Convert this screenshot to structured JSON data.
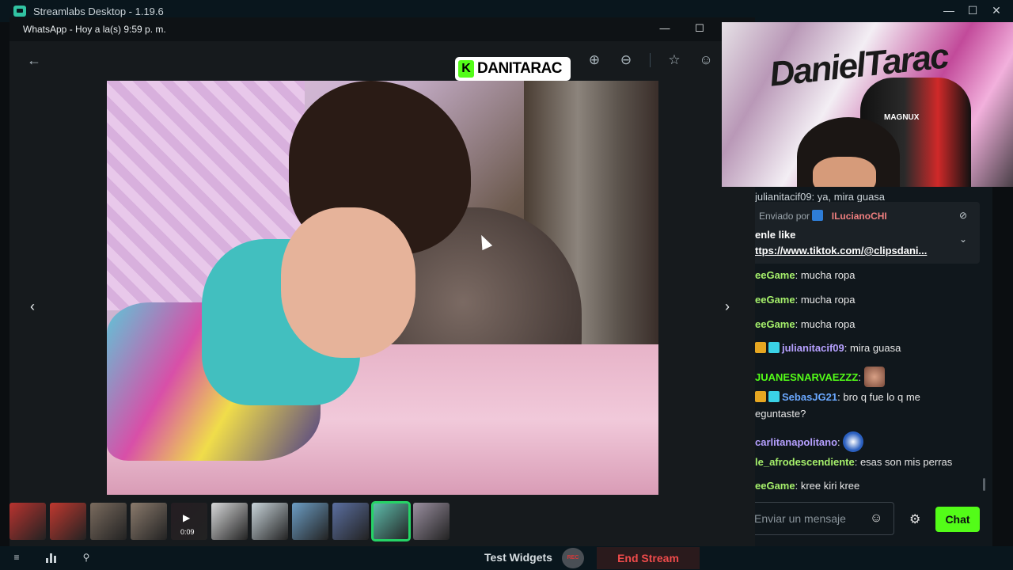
{
  "app": {
    "title": "Streamlabs Desktop - 1.19.6",
    "controls": {
      "minimize": "—",
      "maximize": "☐",
      "close": "✕"
    }
  },
  "whatsapp": {
    "title": "WhatsApp - Hoy a la(s) 9:59 p. m.",
    "controls": {
      "minimize": "—",
      "maximize": "☐"
    },
    "back_icon": "←",
    "prev_icon": "‹",
    "next_icon": "›",
    "toolbar": {
      "zoom_in": "⊕",
      "zoom_out": "⊖",
      "star": "☆",
      "emoji": "☺"
    },
    "thumbnails": [
      {
        "color": "#b9332f"
      },
      {
        "color": "#c0382f"
      },
      {
        "color": "#7a6b5e"
      },
      {
        "color": "#8a7a6c"
      },
      {
        "color": "#241d22",
        "duration": "0:09"
      },
      {
        "color": "#d7d8d9"
      },
      {
        "color": "#c8d4da"
      },
      {
        "color": "#6c9dc4"
      },
      {
        "color": "#5b6fa0"
      },
      {
        "color": "#5fbfae",
        "selected": true
      },
      {
        "color": "#9a8fa0"
      }
    ]
  },
  "overlay": {
    "kick_letter": "K",
    "kick_name": "DANITARAC"
  },
  "webcam": {
    "graffiti": "DanielTarac",
    "chair_label": "MAGNUX"
  },
  "chat": {
    "top_line": "julianitacif09: ya, mira guasa",
    "pinned": {
      "sent_by": "Enviado por",
      "sender": "ILucianoCHI",
      "line1": "enle like",
      "line2": "ttps://www.tiktok.com/@clipsdani..."
    },
    "messages": [
      {
        "user": "eeGame",
        "text": "mucha ropa",
        "color": "u-lime"
      },
      {
        "user": "eeGame",
        "text": "mucha ropa",
        "color": "u-lime"
      },
      {
        "user": "eeGame",
        "text": "mucha ropa",
        "color": "u-lime"
      },
      {
        "user": "julianitacif09",
        "text": "mira guasa",
        "color": "u-purple"
      },
      {
        "user": "JUANESNARVAEZZZ",
        "text": "",
        "color": "u-green"
      },
      {
        "user": "SebasJG21",
        "text": "bro q fue lo q me",
        "color": "u-blue"
      },
      {
        "user": "",
        "text": "eguntaste?",
        "color": ""
      },
      {
        "user": "carlitanapolitano",
        "text": "",
        "color": "u-purple"
      },
      {
        "user": "le_afrodescendiente",
        "text": "esas son mis perras",
        "color": "u-lime"
      },
      {
        "user": "eeGame",
        "text": "kree kiri kree",
        "color": "u-lime"
      }
    ],
    "input_placeholder": "Enviar un mensaje",
    "send_button": "Chat"
  },
  "bottom_bar": {
    "test_widgets": "Test Widgets",
    "rec": "REC",
    "end_stream": "End Stream"
  }
}
